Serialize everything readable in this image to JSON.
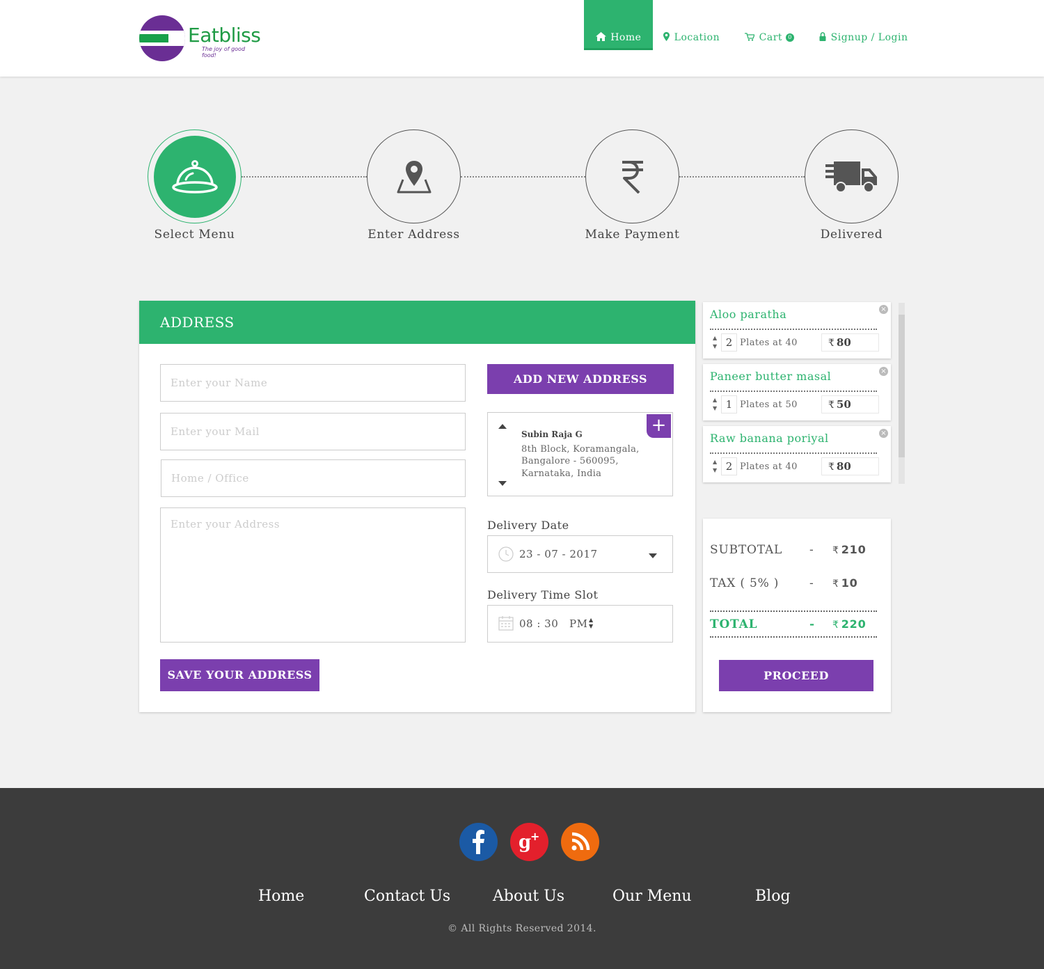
{
  "brand": {
    "name": "Eatbliss",
    "tagline": "The joy of good food!",
    "green": "#2db36f",
    "purple": "#7b3fae"
  },
  "nav": {
    "home": "Home",
    "location": "Location",
    "cart": "Cart",
    "cart_count": "0",
    "signup": "Signup / Login",
    "icons": {
      "home": "home-icon",
      "location": "map-marker-icon",
      "cart": "cart-icon",
      "signup": "lock-icon"
    }
  },
  "steps": [
    {
      "label": "Select Menu",
      "icon": "cloche-icon",
      "active": true
    },
    {
      "label": "Enter Address",
      "icon": "map-pin-icon",
      "active": false
    },
    {
      "label": "Make Payment",
      "icon": "rupee-icon",
      "active": false
    },
    {
      "label": "Delivered",
      "icon": "truck-icon",
      "active": false
    }
  ],
  "address_panel": {
    "title": "ADDRESS",
    "name_placeholder": "Enter your Name",
    "mail_placeholder": "Enter your Mail",
    "type_placeholder": "Home / Office",
    "address_placeholder": "Enter your Address",
    "save_button": "SAVE YOUR ADDRESS",
    "add_new_button": "ADD NEW ADDRESS",
    "saved_address": {
      "name": "Subin Raja G",
      "line1": "8th Block, Koramangala,",
      "line2": "Bangalore - 560095,",
      "line3": "Karnataka, India"
    },
    "delivery_date_label": "Delivery Date",
    "delivery_date_value": "23 - 07 - 2017",
    "delivery_slot_label": "Delivery Time Slot",
    "delivery_time_value": "08 : 30",
    "delivery_ampm": "PM"
  },
  "cart_items": [
    {
      "name": "Aloo paratha",
      "qty": "2",
      "plates": "Plates at 40",
      "price": "80"
    },
    {
      "name": "Paneer butter masal",
      "qty": "1",
      "plates": "Plates at 50",
      "price": "50"
    },
    {
      "name": "Raw banana poriyal",
      "qty": "2",
      "plates": "Plates at 40",
      "price": "80"
    }
  ],
  "summary": {
    "subtotal_label": "SUBTOTAL",
    "subtotal": "210",
    "tax_label": "TAX ( 5% )",
    "tax": "10",
    "total_label": "TOTAL",
    "total": "220",
    "dash": "-",
    "currency": "₹",
    "proceed": "PROCEED"
  },
  "footer": {
    "social": [
      {
        "name": "facebook-icon",
        "color": "#1b5aa5",
        "glyph": "f"
      },
      {
        "name": "google-plus-icon",
        "color": "#e3202c",
        "glyph": "g+"
      },
      {
        "name": "rss-icon",
        "color": "#ef6b0f",
        "glyph": "rss"
      }
    ],
    "links": [
      "Home",
      "Contact Us",
      "About Us",
      "Our Menu",
      "Blog"
    ],
    "copyright": "© All Rights Reserved 2014."
  }
}
